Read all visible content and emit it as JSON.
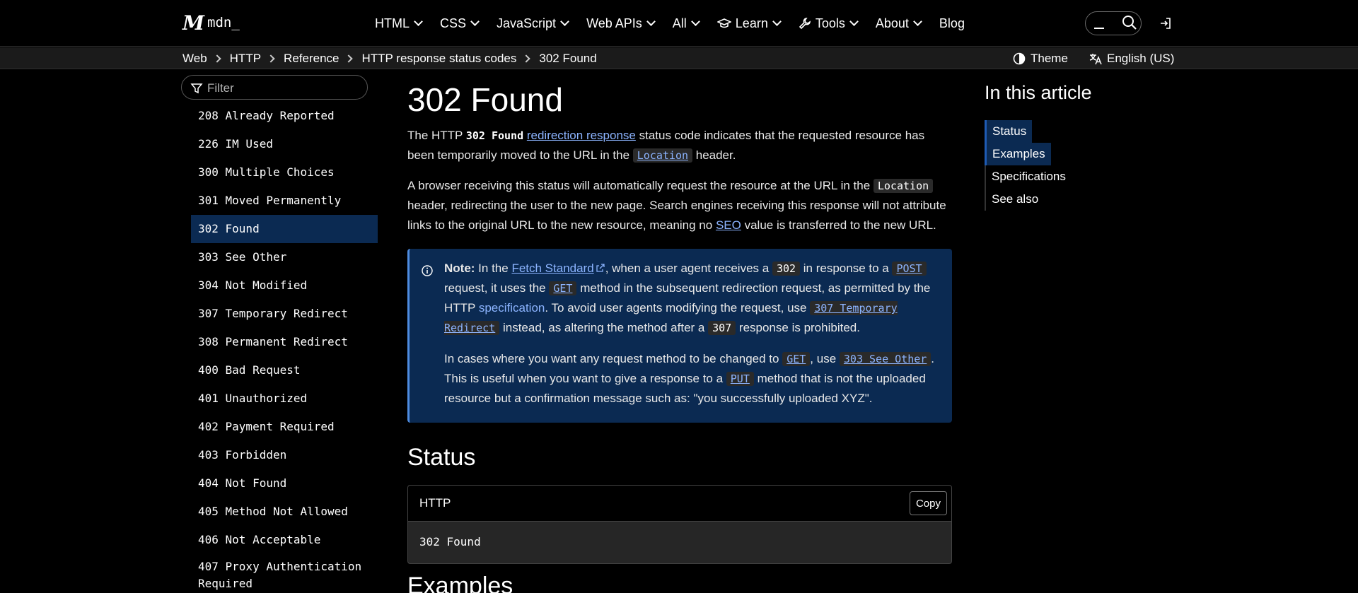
{
  "nav": {
    "logo_text": "mdn_",
    "items": [
      {
        "label": "HTML",
        "dropdown": true
      },
      {
        "label": "CSS",
        "dropdown": true
      },
      {
        "label": "JavaScript",
        "dropdown": true
      },
      {
        "label": "Web APIs",
        "dropdown": true
      },
      {
        "label": "All",
        "dropdown": true
      },
      {
        "label": "Learn",
        "dropdown": true
      },
      {
        "label": "Tools",
        "dropdown": true
      },
      {
        "label": "About",
        "dropdown": true
      },
      {
        "label": "Blog",
        "dropdown": false
      }
    ]
  },
  "breadcrumb": [
    "Web",
    "HTTP",
    "Reference",
    "HTTP response status codes",
    "302 Found"
  ],
  "theme_label": "Theme",
  "language_label": "English (US)",
  "sidebar": {
    "filter_placeholder": "Filter",
    "items": [
      "208 Already Reported",
      "226 IM Used",
      "300 Multiple Choices",
      "301 Moved Permanently",
      "302 Found",
      "303 See Other",
      "304 Not Modified",
      "307 Temporary Redirect",
      "308 Permanent Redirect",
      "400 Bad Request",
      "401 Unauthorized",
      "402 Payment Required",
      "403 Forbidden",
      "404 Not Found",
      "405 Method Not Allowed",
      "406 Not Acceptable",
      "407 Proxy Authentication Required"
    ],
    "active_index": 4
  },
  "article": {
    "title": "302 Found",
    "p1": {
      "t1": "The HTTP ",
      "code1": "302 Found",
      "link1": "redirection response",
      "t2": " status code indicates that the requested resource has been temporarily moved to the URL in the ",
      "code2": "Location",
      "t3": " header."
    },
    "p2": {
      "t1": "A browser receiving this status will automatically request the resource at the URL in the ",
      "code1": "Location",
      "t2": " header, redirecting the user to the new page. Search engines receiving this response will not attribute links to the original URL to the new resource, meaning no ",
      "link1": "SEO",
      "t3": " value is transferred to the new URL."
    },
    "note": {
      "label": "Note:",
      "p1": {
        "t1": " In the ",
        "link1": "Fetch Standard",
        "t2": ", when a user agent receives a ",
        "code1": "302",
        "t3": " in response to a ",
        "code2": "POST",
        "t4": " request, it uses the ",
        "code3": "GET",
        "t5": " method in the subsequent redirection request, as permitted by the HTTP ",
        "link2": "specification",
        "t6": ". To avoid user agents modifying the request, use ",
        "code4": "307 Temporary Redirect",
        "t7": " instead, as altering the method after a ",
        "code5": "307",
        "t8": " response is prohibited."
      },
      "p2": {
        "t1": "In cases where you want any request method to be changed to ",
        "code1": "GET",
        "t2": ", use ",
        "code2": "303 See Other",
        "t3": ". This is useful when you want to give a response to a ",
        "code3": "PUT",
        "t4": " method that is not the uploaded resource but a confirmation message such as: \"you successfully uploaded XYZ\"."
      }
    },
    "status_heading": "Status",
    "codebox": {
      "lang": "HTTP",
      "copy_label": "Copy",
      "code": "302 Found"
    },
    "examples_heading": "Examples"
  },
  "toc": {
    "title": "In this article",
    "items": [
      "Status",
      "Examples",
      "Specifications",
      "See also"
    ],
    "active": [
      0,
      1
    ]
  },
  "colors": {
    "accent_link": "#8cb4ff",
    "note_bg": "#0b2a52",
    "active_bg": "#0b2a52"
  }
}
